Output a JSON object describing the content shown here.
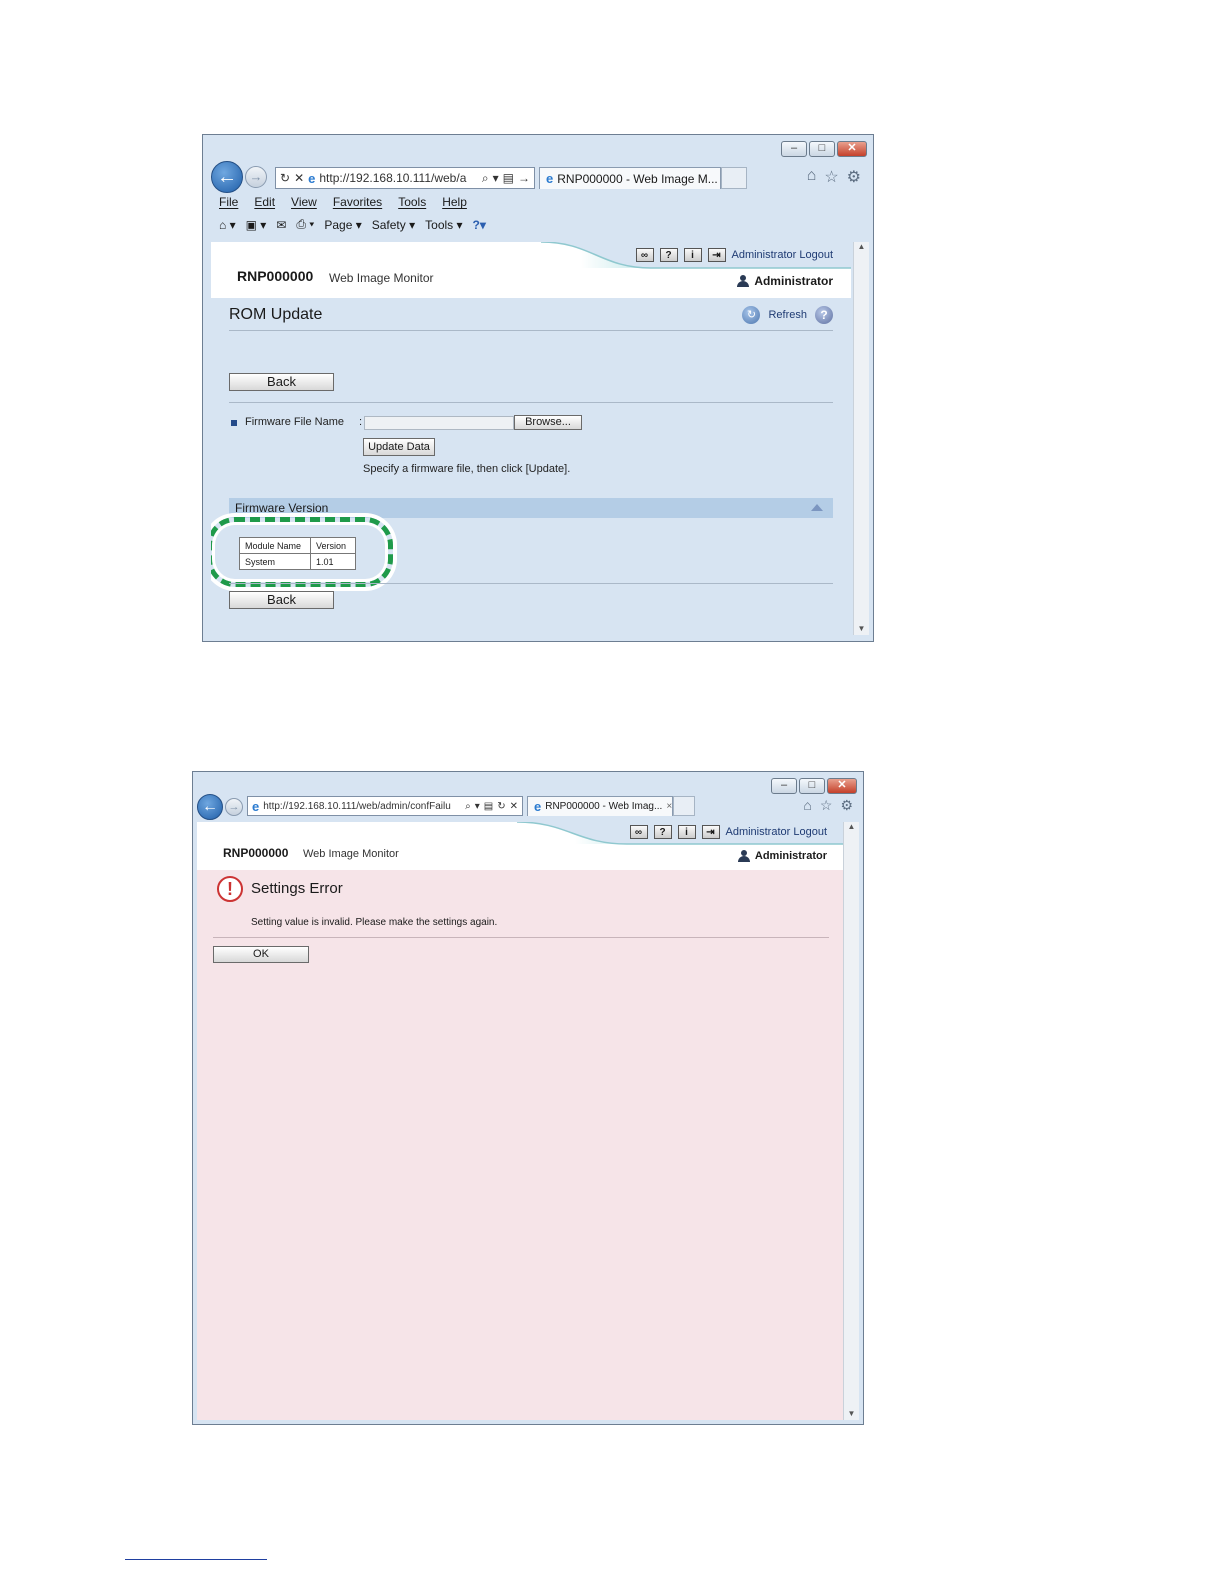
{
  "window1": {
    "url": "http://192.168.10.111/web/a",
    "tab_title": "RNP000000 - Web Image M...",
    "tab_close": "×",
    "menu": [
      "File",
      "Edit",
      "View",
      "Favorites",
      "Tools",
      "Help"
    ],
    "commands": {
      "page": "Page ▾",
      "safety": "Safety ▾",
      "tools": "Tools ▾"
    },
    "header": {
      "admin_logout": "Administrator Logout",
      "brand": "RNP000000",
      "brand_sub": "Web Image Monitor",
      "user": "Administrator"
    },
    "page_title": "ROM Update",
    "refresh_label": "Refresh",
    "back_label": "Back",
    "firmware_label": "Firmware File Name",
    "colon": ":",
    "browse_label": "Browse...",
    "update_label": "Update Data",
    "instruction": "Specify a firmware file, then click [Update].",
    "section_title": "Firmware Version",
    "table": {
      "headers": [
        "Module Name",
        "Version"
      ],
      "rows": [
        [
          "System",
          "1.01"
        ]
      ]
    },
    "back_label_bottom": "Back"
  },
  "window2": {
    "url": "http://192.168.10.111/web/admin/confFailu",
    "tab_title": "RNP000000 - Web Imag...",
    "tab_close": "×",
    "header": {
      "admin_logout": "Administrator Logout",
      "brand": "RNP000000",
      "brand_sub": "Web Image Monitor",
      "user": "Administrator"
    },
    "error_title": "Settings Error",
    "error_message": "Setting value is invalid. Please make the settings again.",
    "ok_label": "OK"
  },
  "colors": {
    "accent_green": "#1f9a4a",
    "error_red": "#cc3333",
    "pink_bg": "#f6e4e8",
    "panel_blue": "#d7e4f2"
  }
}
